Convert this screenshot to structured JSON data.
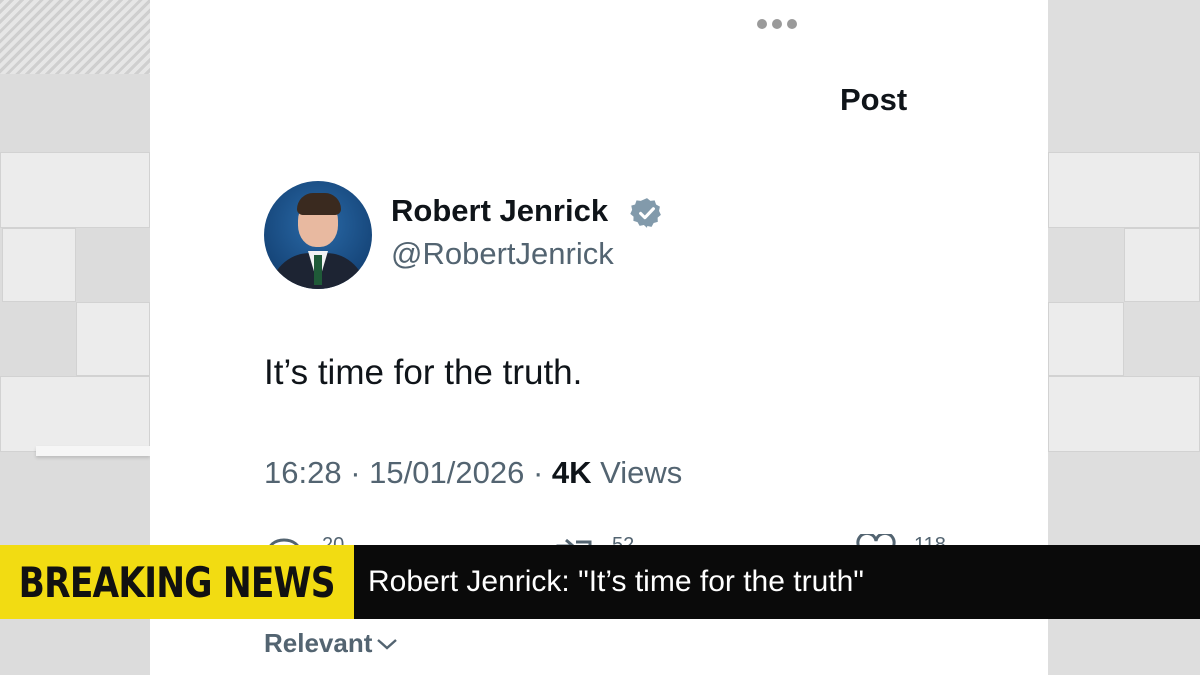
{
  "post_view": {
    "title": "Post",
    "more_icon": "more-horizontal-icon",
    "author": {
      "display_name": "Robert Jenrick",
      "handle": "@RobertJenrick",
      "verified_icon": "verified-badge-icon",
      "verified_color": "#829aab"
    },
    "text": "It’s time for the truth.",
    "meta": {
      "time": "16:28",
      "date": "15/01/2026",
      "views_count": "4K",
      "views_label": "Views"
    },
    "actions": [
      {
        "icon": "reply-icon",
        "count": "20"
      },
      {
        "icon": "repost-icon",
        "count": "52"
      },
      {
        "icon": "like-icon",
        "count": "118"
      }
    ],
    "sort_filter": {
      "label": "Relevant",
      "icon": "chevron-down-icon"
    }
  },
  "breaking_news": {
    "label": "BREAKING NEWS",
    "headline": "Robert Jenrick: \"It’s time for the truth\"",
    "label_bg": "#f2dc12",
    "headline_bg": "#0a0a0a"
  }
}
